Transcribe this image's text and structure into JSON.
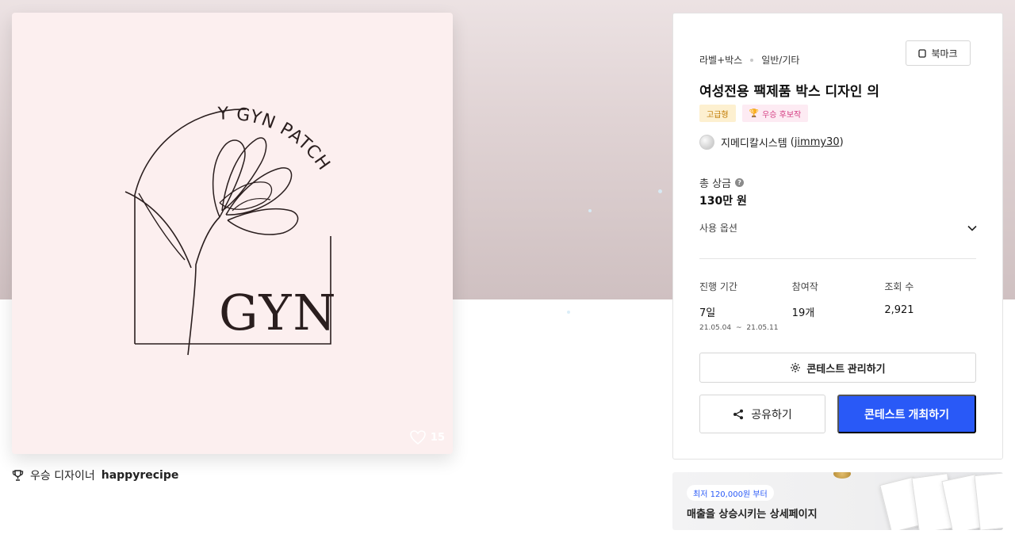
{
  "artwork": {
    "logo_text_top": "Y GYN PATCH",
    "logo_text_main": "GYN",
    "like_count": "15"
  },
  "winner": {
    "prefix": "우승 디자이너",
    "designer": "happyrecipe"
  },
  "contest": {
    "category": "라벨+박스",
    "subcategory": "일반/기타",
    "bookmark_label": "북마크",
    "title": "여성전용 팩제품 박스 디자인 의",
    "badges": [
      "고급형",
      "우승 후보작"
    ],
    "host_name": "지메디칼시스템",
    "host_handle": "jimmy30",
    "host_paren_open": "(",
    "host_paren_close": ")",
    "prize_label": "총 상금",
    "prize_value": "130만 원",
    "usage_label": "사용 옵션",
    "stats": {
      "period_label": "진행 기간",
      "period_value": "7일",
      "period_start": "21.05.04",
      "period_tilde": "~",
      "period_end": "21.05.11",
      "entries_label": "참여작",
      "entries_value": "19개",
      "views_label": "조회 수",
      "views_value": "2,921"
    },
    "manage_label": "콘테스트 관리하기",
    "share_label": "공유하기",
    "host_button_label": "콘테스트 개최하기"
  },
  "ad": {
    "chip": "최저 120,000원 부터",
    "headline": "매출을 상승시키는 상세페이지"
  },
  "colors": {
    "primary": "#2959f7",
    "premium_bg": "#fdf0d0",
    "candidate_bg": "#fdebf3"
  }
}
